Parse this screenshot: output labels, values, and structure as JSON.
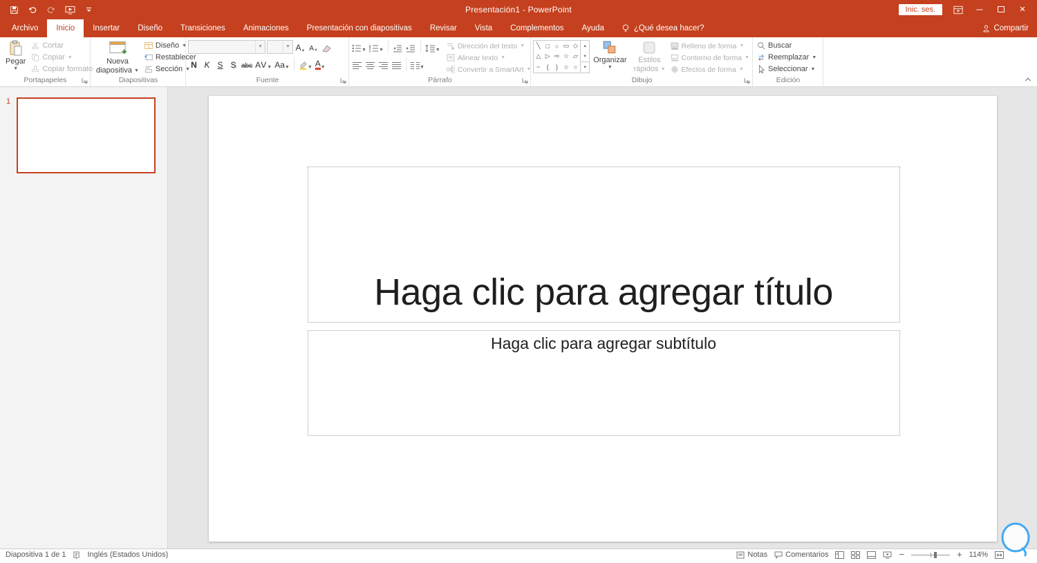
{
  "colors": {
    "accent": "#C5401E"
  },
  "titlebar": {
    "title": "Presentación1 - PowerPoint",
    "signin_label": "Inic. ses."
  },
  "tabs": {
    "file": "Archivo",
    "items": [
      "Inicio",
      "Insertar",
      "Diseño",
      "Transiciones",
      "Animaciones",
      "Presentación con diapositivas",
      "Revisar",
      "Vista",
      "Complementos",
      "Ayuda"
    ],
    "tellme": "¿Qué desea hacer?",
    "share": "Compartir"
  },
  "ribbon": {
    "clipboard": {
      "title": "Portapapeles",
      "paste": "Pegar",
      "cut": "Cortar",
      "copy": "Copiar",
      "format_painter": "Copiar formato"
    },
    "slides": {
      "title": "Diapositivas",
      "new_slide_line1": "Nueva",
      "new_slide_line2": "diapositiva",
      "layout": "Diseño",
      "reset": "Restablecer",
      "section": "Sección"
    },
    "font": {
      "title": "Fuente",
      "bold": "N",
      "italic": "K",
      "underline": "S",
      "shadow": "S",
      "strikethrough": "abc",
      "char_spacing": "AV",
      "change_case": "Aa",
      "grow": "A",
      "shrink": "A",
      "color": "A"
    },
    "paragraph": {
      "title": "Párrafo",
      "text_direction": "Dirección del texto",
      "align_text": "Alinear texto",
      "smartart": "Convertir a SmartArt"
    },
    "drawing": {
      "title": "Dibujo",
      "shapes_gallery": [
        "╲",
        "□",
        "○",
        "▭",
        "◇",
        "△",
        "▷",
        "⇨",
        "☆",
        "▱",
        "~",
        "{",
        "}",
        "☆",
        "○"
      ],
      "arrange": "Organizar",
      "quick_styles_line1": "Estilos",
      "quick_styles_line2": "rápidos",
      "shape_fill": "Relleno de forma",
      "shape_outline": "Contorno de forma",
      "shape_effects": "Efectos de forma"
    },
    "editing": {
      "title": "Edición",
      "find": "Buscar",
      "replace": "Reemplazar",
      "select": "Seleccionar"
    }
  },
  "slides_panel": {
    "slide_number": "1"
  },
  "slide": {
    "title_placeholder": "Haga clic para agregar título",
    "subtitle_placeholder": "Haga clic para agregar subtítulo"
  },
  "statusbar": {
    "slide_info": "Diapositiva 1 de 1",
    "language": "Inglés (Estados Unidos)",
    "notes": "Notas",
    "comments": "Comentarios",
    "zoom": "114%"
  }
}
